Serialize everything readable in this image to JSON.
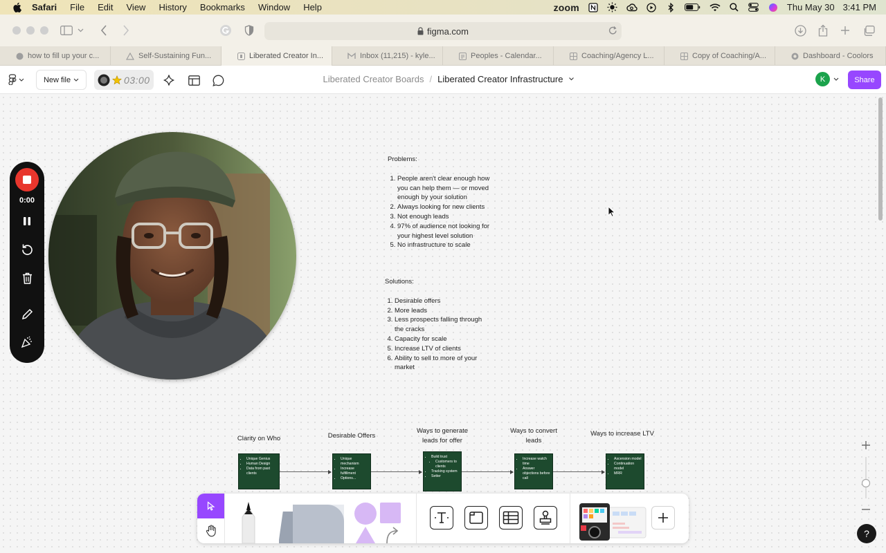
{
  "menubar": {
    "app": "Safari",
    "items": [
      "File",
      "Edit",
      "View",
      "History",
      "Bookmarks",
      "Window",
      "Help"
    ],
    "zoom_label": "zoom",
    "date": "Thu May 30",
    "time": "3:41 PM"
  },
  "browser": {
    "url": "figma.com",
    "tabs": [
      {
        "label": "how to fill up your c...",
        "active": false
      },
      {
        "label": "Self-Sustaining Fun...",
        "active": false
      },
      {
        "label": "Liberated Creator In...",
        "active": true
      },
      {
        "label": "Inbox (11,215) - kyle...",
        "active": false
      },
      {
        "label": "Peoples - Calendar...",
        "active": false
      },
      {
        "label": "Coaching/Agency L...",
        "active": false
      },
      {
        "label": "Copy of Coaching/A...",
        "active": false
      },
      {
        "label": "Dashboard - Coolors",
        "active": false
      }
    ]
  },
  "figma": {
    "new_file_label": "New file",
    "timer": "03:00",
    "breadcrumb_parent": "Liberated Creator Boards",
    "breadcrumb_sep": "/",
    "file_title": "Liberated Creator Infrastructure",
    "avatar_initial": "K",
    "share_label": "Share",
    "accent_color": "#9747ff"
  },
  "recorder": {
    "elapsed": "0:00"
  },
  "problems": {
    "heading": "Problems:",
    "items": [
      "People aren't clear enough how you can help them — or moved enough by your solution",
      "Always looking for new clients",
      "Not enough leads",
      "97% of audience not looking for your highest level solution",
      "No infrastructure to scale"
    ]
  },
  "solutions": {
    "heading": "Solutions:",
    "items": [
      "Desirable offers",
      "More leads",
      "Less prospects falling through the cracks",
      "Capacity for scale",
      "Increase LTV of clients",
      "Ability to sell to more of your market"
    ]
  },
  "flow": {
    "box_color": "#1d4a2e",
    "steps": [
      {
        "label": "Clarity on Who",
        "bullets": [
          "Unique Genius",
          "Human Design",
          "Data from past clients"
        ]
      },
      {
        "label": "Desirable Offers",
        "bullets": [
          "Unique mechanism",
          "Increase fulfillment",
          "Options..."
        ]
      },
      {
        "label": "Ways to generate leads for offer",
        "bullets": [
          "Build trust",
          "Customers to clients",
          "Tracking system",
          "Setter"
        ]
      },
      {
        "label": "Ways to convert leads",
        "bullets": [
          "Increase watch time",
          "Answer objections before call"
        ]
      },
      {
        "label": "Ways to increase LTV",
        "bullets": [
          "Ascension model",
          "Continuation model",
          "MRR"
        ]
      }
    ]
  },
  "help_label": "?"
}
